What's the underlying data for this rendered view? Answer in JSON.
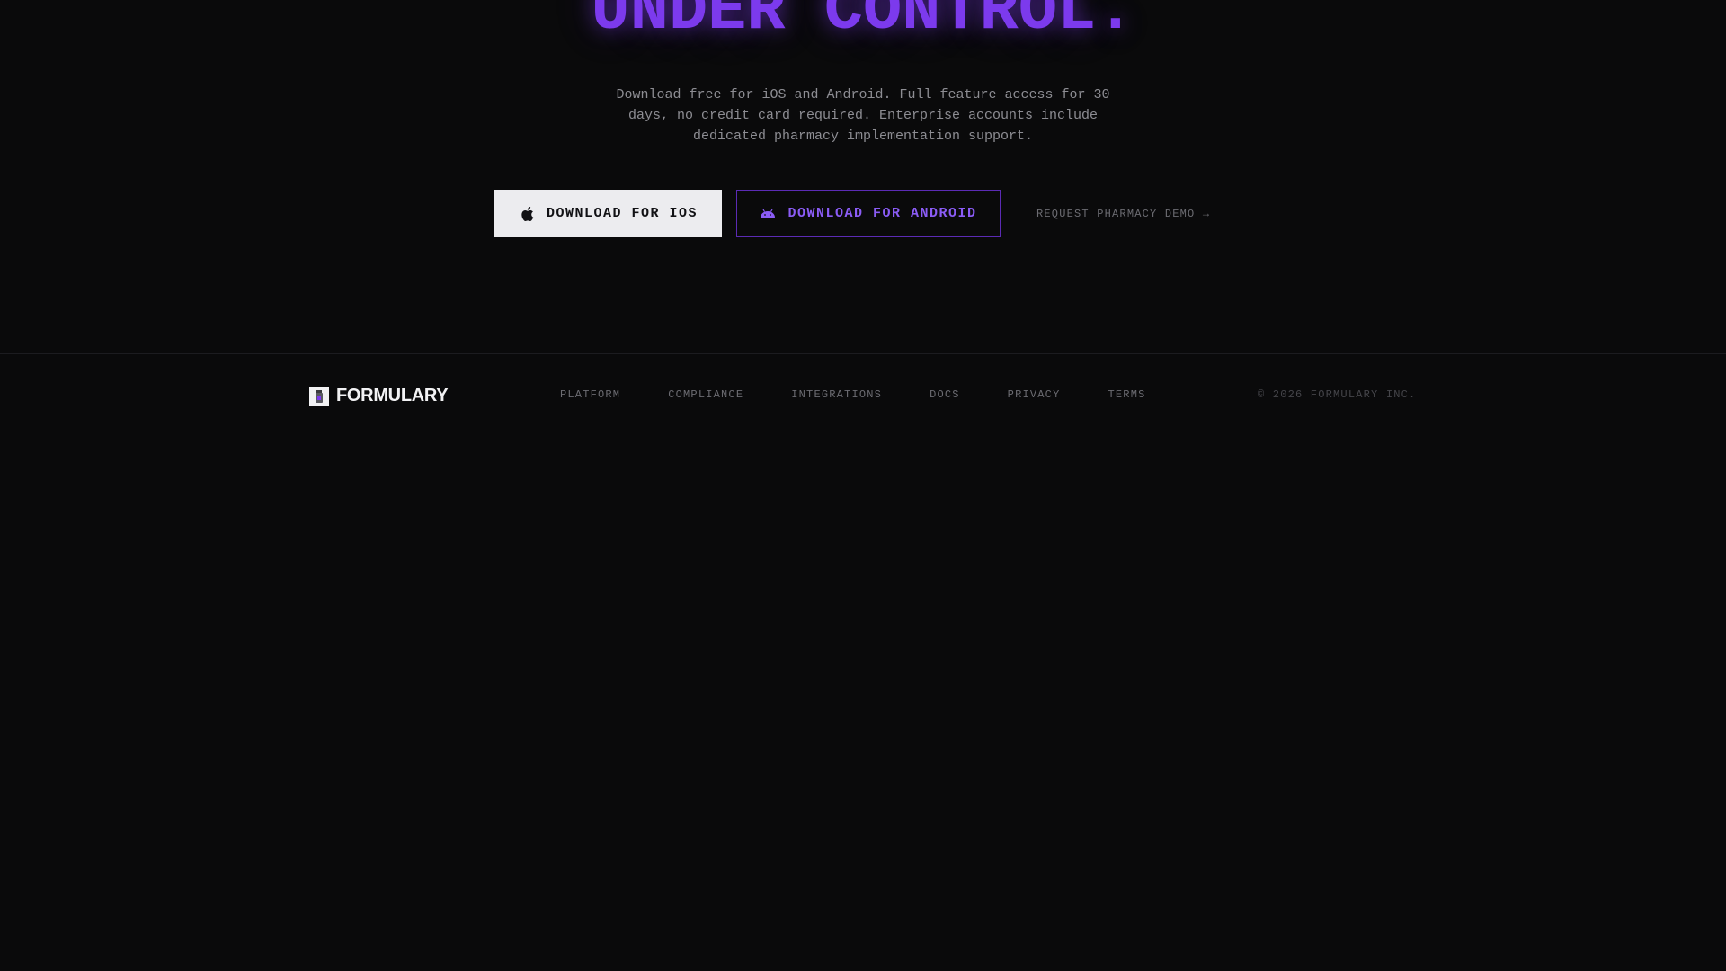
{
  "hero": {
    "headline": "UNDER CONTROL.",
    "subtext": "Download free for iOS and Android. Full feature access for 30 days, no credit card required. Enterprise accounts include dedicated pharmacy implementation support.",
    "ios_button": {
      "label": "DOWNLOAD FOR IOS",
      "icon": "apple-icon"
    },
    "android_button": {
      "label": "DOWNLOAD FOR ANDROID",
      "icon": "android-icon"
    },
    "demo_link": "REQUEST PHARMACY DEMO →"
  },
  "footer": {
    "brand": {
      "name": "FORMULARY",
      "icon": "formulary-logo-icon"
    },
    "nav": [
      "PLATFORM",
      "COMPLIANCE",
      "INTEGRATIONS",
      "DOCS",
      "PRIVACY",
      "TERMS"
    ],
    "copyright": "© 2026 FORMULARY INC."
  },
  "colors": {
    "background": "#0a0a0b",
    "accent": "#7c3aed",
    "accent_text": "#8b5cf6",
    "muted_text": "#6c6c72"
  }
}
